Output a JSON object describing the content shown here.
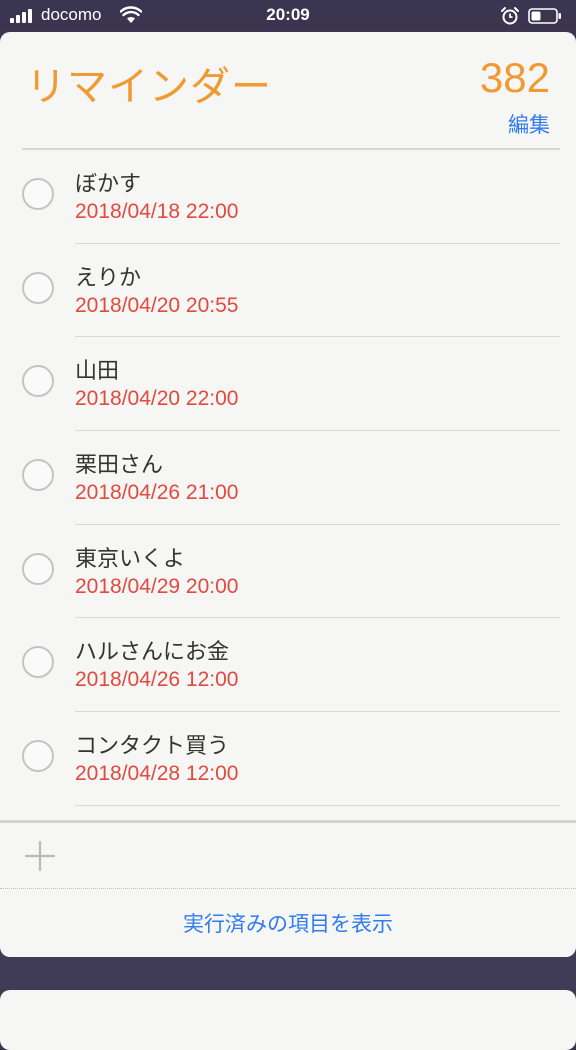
{
  "status_bar": {
    "carrier": "docomo",
    "time": "20:09"
  },
  "reminders": {
    "title": "リマインダー",
    "count": "382",
    "edit_label": "編集",
    "items": [
      {
        "title": "ぼかす",
        "date": "2018/04/18 22:00"
      },
      {
        "title": "えりか",
        "date": "2018/04/20 20:55"
      },
      {
        "title": "山田",
        "date": "2018/04/20 22:00"
      },
      {
        "title": "栗田さん",
        "date": "2018/04/26 21:00"
      },
      {
        "title": "東京いくよ",
        "date": "2018/04/29 20:00"
      },
      {
        "title": "ハルさんにお金",
        "date": "2018/04/26 12:00"
      },
      {
        "title": "コンタクト買う",
        "date": "2018/04/28 12:00"
      }
    ],
    "show_completed_label": "実行済みの項目を表示"
  },
  "colors": {
    "accent_orange": "#f09a32",
    "link_blue": "#2f7bf0",
    "date_red": "#e24a3f"
  },
  "icons": [
    "signal-bars-icon",
    "wifi-icon",
    "alarm-icon",
    "battery-icon",
    "add-icon",
    "circle-checkbox-icon"
  ]
}
